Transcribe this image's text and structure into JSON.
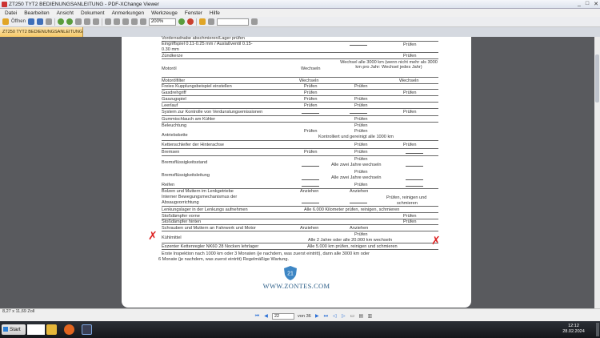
{
  "window": {
    "title": "ZT250 TYT2 BEDIENUNGSANLEITUNG - PDF-XChange Viewer",
    "controls": [
      "_",
      "□",
      "✕"
    ]
  },
  "menu": {
    "items": [
      "Datei",
      "Bearbeiten",
      "Ansicht",
      "Dokument",
      "Anmerkungen",
      "Werkzeuge",
      "Fenster",
      "Hilfe"
    ]
  },
  "toolbar": {
    "open_label": "Öffnen",
    "zoom_value": "200%"
  },
  "tab": {
    "label": "ZT250 TYT2 BEDIENUNGSANLEITUNG"
  },
  "doc": {
    "rows": [
      {
        "c1": "Vorderradnabe abschmieren/Lager prüfen",
        "c2": "",
        "c3": "",
        "c4": ""
      },
      {
        "c1": "Eingriffspiel 0.11-0.25 mm / Auslaßventil 0.15-",
        "c2": "",
        "c3": "—",
        "c4": "Prüfen"
      },
      {
        "c1": "0.30 mm",
        "c2": "",
        "c3": "",
        "c4": ""
      },
      {
        "c1": "Zündkerze",
        "c2": "",
        "c3": "",
        "c4": "Prüfen"
      },
      {
        "c1": "Motoröl",
        "c2": "Wechseln",
        "c3": "Wechsel alle 3000 km (wenn nicht mehr als 3000 km pro Jahr: Wechsel jedes Jahr)",
        "c4": ""
      },
      {
        "c1": "Motorölfilter",
        "c2": "Wechseln",
        "c3": "",
        "c4": "Wechseln"
      },
      {
        "c1": "Freies Kupplungsbeispiel einstellen",
        "c2": "Prüfen",
        "c3": "Prüfen",
        "c4": ""
      },
      {
        "c1": "Gasdrehgriff",
        "c2": "Prüfen",
        "c3": "",
        "c4": "Prüfen"
      },
      {
        "c1": "Gaszugspiel",
        "c2": "Prüfen",
        "c3": "Prüfen",
        "c4": ""
      },
      {
        "c1": "Leerlauf",
        "c2": "Prüfen",
        "c3": "Prüfen",
        "c4": ""
      },
      {
        "c1": "System zur Kontrolle von Verdunstungsemissionen",
        "c2": "",
        "c3": "",
        "c4": "Prüfen"
      },
      {
        "c1": "Gummischlauch am Kühler",
        "c2": "",
        "c3": "Prüfen",
        "c4": ""
      },
      {
        "c1": "Beleuchtung",
        "c2": "",
        "c3": "Prüfen",
        "c4": ""
      },
      {
        "c1": "Antriebskette",
        "c2": "Prüfen",
        "c3": "Prüfen",
        "c4": ""
      },
      {
        "c1": "",
        "c2": "",
        "c3": "Kontrolliert und gereinigt alle 1000 km",
        "c4": ""
      },
      {
        "c1": "Kettenschleifer der Hinterachse",
        "c2": "",
        "c3": "Prüfen",
        "c4": "Prüfen"
      },
      {
        "c1": "Bremsen",
        "c2": "Prüfen",
        "c3": "Prüfen",
        "c4": ""
      },
      {
        "c1": "Bremsflüssigkeitsstand",
        "c2": "",
        "c3": "Prüfen",
        "c4": ""
      },
      {
        "c1": "",
        "c2": "",
        "c3": "Alle zwei Jahre wechseln",
        "c4": ""
      },
      {
        "c1": "Bremsflüssigkeitsleitung",
        "c2": "",
        "c3": "Prüfen",
        "c4": ""
      },
      {
        "c1": "",
        "c2": "",
        "c3": "Alle zwei Jahre wechseln",
        "c4": ""
      },
      {
        "c1": "Reifen",
        "c2": "",
        "c3": "Prüfen",
        "c4": ""
      },
      {
        "c1": "Bolzen und Muttern im Lenkgetriebe",
        "c2": "Anziehen",
        "c3": "Anziehen",
        "c4": ""
      },
      {
        "c1": "Interner Bewegungsmechanismus der",
        "c2": "",
        "c3": "",
        "c4": "Prüfen, reinigen und"
      },
      {
        "c1": "Absaugvorrichtung",
        "c2": "",
        "c3": "",
        "c4": "schmieren"
      },
      {
        "c1": "Lenkungslager in der Lenkungs aufnehmen",
        "c2": "Alle 6.000 Kilometer prüfen, reinigen, schmieren",
        "c3": "",
        "c4": ""
      },
      {
        "c1": "Stoßdämpfer vorne",
        "c2": "",
        "c3": "",
        "c4": "Prüfen"
      },
      {
        "c1": "Stoßdämpfer hinten",
        "c2": "",
        "c3": "",
        "c4": "Prüfen"
      },
      {
        "c1": "Schrauben und Muttern an Fahrwerk und Motor",
        "c2": "Anziehen",
        "c3": "Anziehen",
        "c4": ""
      },
      {
        "c1": "Kühlmittel",
        "c2": "",
        "c3": "Prüfen",
        "c4": ""
      },
      {
        "c1": "",
        "c2": "",
        "c3": "Alle 2 Jahre oder alle 20.000 km wechseln",
        "c4": ""
      },
      {
        "c1": "Exzenter Kettenregler NK60 28 Nocken lehrlager",
        "c2": "Alle 5.000 km prüfen, reinigen und schmieren",
        "c3": "",
        "c4": ""
      }
    ],
    "note_line1": "Erste Inspektion nach 1000 km oder 3 Monaten (je nachdem, was zuerst eintritt), dann alle 3000 km oder",
    "note_line2": "6 Monate (je nachdem, was zuerst eintritt) Regelmäßige Wartung.",
    "page_badge": "21",
    "website": "WWW.ZONTES.COM"
  },
  "status": {
    "size": "8,27 x 11,69 Zoll",
    "page_input": "22",
    "page_total": "von 36"
  },
  "taskbar": {
    "start_label": "Start",
    "time": "12:12",
    "date": "28.02.2024"
  },
  "colors": {
    "tab": "#f6c866",
    "annotation": "#dd2222",
    "link": "#2a5c86",
    "nav": "#2a6fd6"
  }
}
